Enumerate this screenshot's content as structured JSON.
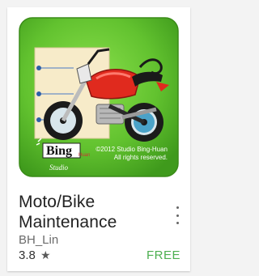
{
  "app": {
    "title": "Moto/Bike Maintenance",
    "developer": "BH_Lin",
    "rating": "3.8",
    "rating_icon": "star-icon",
    "price": "FREE",
    "menu_icon": "more-vert-icon"
  },
  "icon": {
    "logo_text": "Bing",
    "logo_subtext": "Huan",
    "logo_script": "Studio",
    "copyright_line1": "©2012 Studio Bing-Huan",
    "copyright_line2": "All rights reserved."
  },
  "colors": {
    "icon_green": "#5dbd2c",
    "accent_green": "#4caf50",
    "bike_red": "#e02a1e"
  }
}
